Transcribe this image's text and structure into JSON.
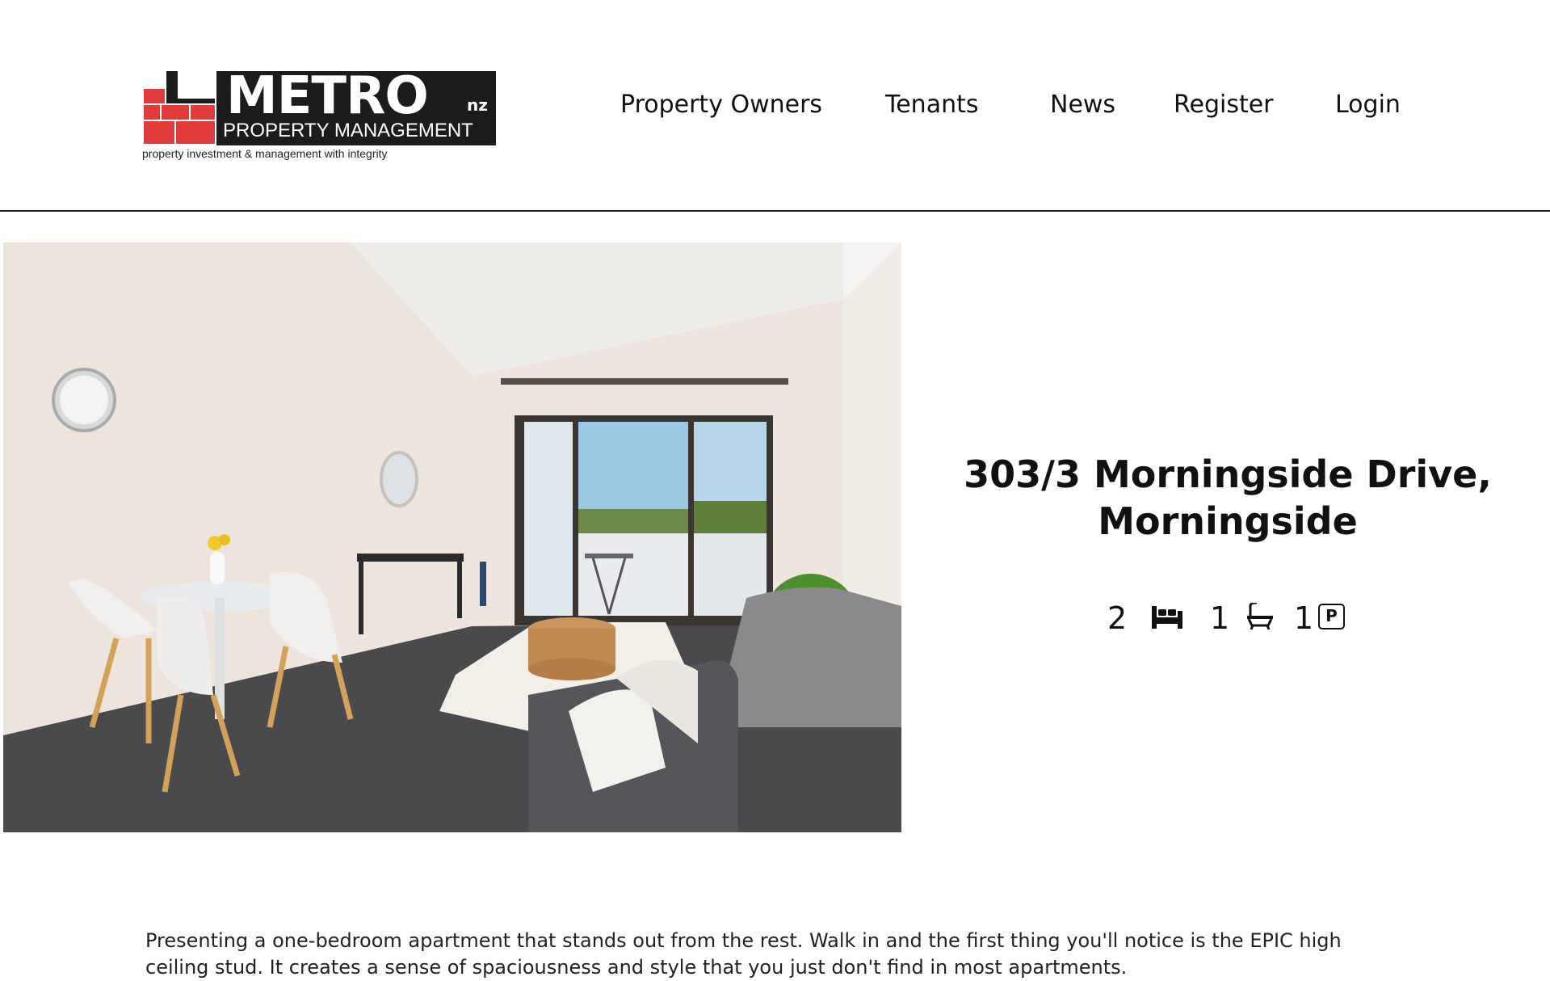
{
  "logo": {
    "brand": "METRO",
    "suffix": "nz",
    "subtitle": "PROPERTY MANAGEMENT",
    "tagline": "property investment & management with integrity"
  },
  "nav": {
    "items": [
      {
        "label": "Property Owners"
      },
      {
        "label": "Tenants"
      },
      {
        "label": "News"
      },
      {
        "label": "Register"
      },
      {
        "label": "Login"
      }
    ]
  },
  "listing": {
    "address_line1": "303/3 Morningside Drive,",
    "address_line2": "Morningside",
    "bedrooms": "2",
    "bathrooms": "1",
    "parking": "1",
    "bedroom_icon": "bed-icon",
    "bathroom_icon": "bath-icon",
    "parking_icon": "parking-icon",
    "parking_glyph": "P",
    "description": "Presenting a one-bedroom apartment that stands out from the rest. Walk in and the first thing you'll notice is the EPIC high ceiling stud. It creates a sense of spaciousness and style that you just don't find in most apartments."
  },
  "colors": {
    "brand_red": "#e23b3b",
    "brand_dark": "#1c1c1c",
    "divider": "#222222"
  }
}
